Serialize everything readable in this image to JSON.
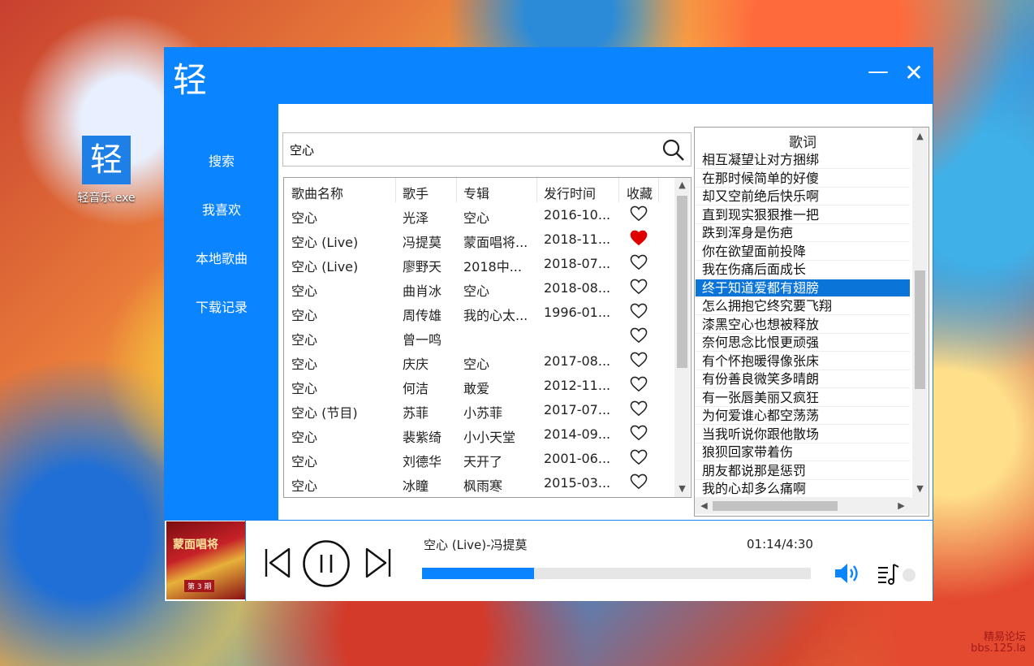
{
  "desktop": {
    "icon_glyph": "轻",
    "icon_label": "轻音乐.exe",
    "watermark_line1": "精易论坛",
    "watermark_line2": "bbs.125.la"
  },
  "window": {
    "title": "轻",
    "minimize_symbol": "—",
    "close_symbol": "✕",
    "accent_color": "#0a84ff"
  },
  "sidebar": {
    "items": [
      {
        "label": "搜索"
      },
      {
        "label": "我喜欢"
      },
      {
        "label": "本地歌曲"
      },
      {
        "label": "下载记录"
      }
    ]
  },
  "search": {
    "value": "空心",
    "icon": "search-icon"
  },
  "table": {
    "headers": [
      "歌曲名称",
      "歌手",
      "专辑",
      "发行时间",
      "收藏"
    ],
    "rows": [
      {
        "name": "空心",
        "artist": "光泽",
        "album": "空心",
        "date": "2016-10...",
        "favorite": false
      },
      {
        "name": "空心 (Live)",
        "artist": "冯提莫",
        "album": "蒙面唱将...",
        "date": "2018-11...",
        "favorite": true
      },
      {
        "name": "空心 (Live)",
        "artist": "廖野天",
        "album": "2018中...",
        "date": "2018-07...",
        "favorite": false
      },
      {
        "name": "空心",
        "artist": "曲肖冰",
        "album": "空心",
        "date": "2018-08...",
        "favorite": false
      },
      {
        "name": "空心",
        "artist": "周传雄",
        "album": "我的心太...",
        "date": "1996-01...",
        "favorite": false
      },
      {
        "name": "空心",
        "artist": "曾一鸣",
        "album": "",
        "date": "",
        "favorite": false
      },
      {
        "name": "空心",
        "artist": "庆庆",
        "album": "空心",
        "date": "2017-08...",
        "favorite": false
      },
      {
        "name": "空心",
        "artist": "何洁",
        "album": "敢爱",
        "date": "2012-11...",
        "favorite": false
      },
      {
        "name": "空心 (节目)",
        "artist": "苏菲",
        "album": "小苏菲",
        "date": "2017-07...",
        "favorite": false
      },
      {
        "name": "空心",
        "artist": "裴紫绮",
        "album": "小小天堂",
        "date": "2014-09...",
        "favorite": false
      },
      {
        "name": "空心",
        "artist": "刘德华",
        "album": "天开了",
        "date": "2001-06...",
        "favorite": false
      },
      {
        "name": "空心",
        "artist": "冰瞳",
        "album": "枫雨寒",
        "date": "2015-03...",
        "favorite": false
      }
    ],
    "favorite_color": "#e00000"
  },
  "lyrics": {
    "title": "歌词",
    "lines": [
      "相互凝望让对方捆绑",
      "在那时候简单的好傻",
      "却又空前绝后快乐啊",
      "直到现实狠狠推一把",
      "跌到浑身是伤疤",
      "你在欲望面前投降",
      "我在伤痛后面成长",
      "终于知道爱都有翅膀",
      "怎么拥抱它终究要飞翔",
      "漆黑空心也想被释放",
      "奈何思念比恨更顽强",
      "有个怀抱暖得像张床",
      "有份善良微笑多晴朗",
      "有一张唇美丽又疯狂",
      "为何爱谁心都空荡荡",
      "当我听说你跟他散场",
      "狼狈回家带着伤",
      "朋友都说那是惩罚",
      "我的心却多么痛啊"
    ],
    "active_index": 7
  },
  "player": {
    "now_playing": "空心 (Live)-冯提莫",
    "time": "01:14/4:30",
    "progress": 0.288,
    "cover_title": "蒙面唱将",
    "cover_episode": "第 3 期",
    "icons": [
      "previous-icon",
      "pause-icon",
      "next-icon",
      "volume-icon",
      "playlist-icon"
    ]
  }
}
